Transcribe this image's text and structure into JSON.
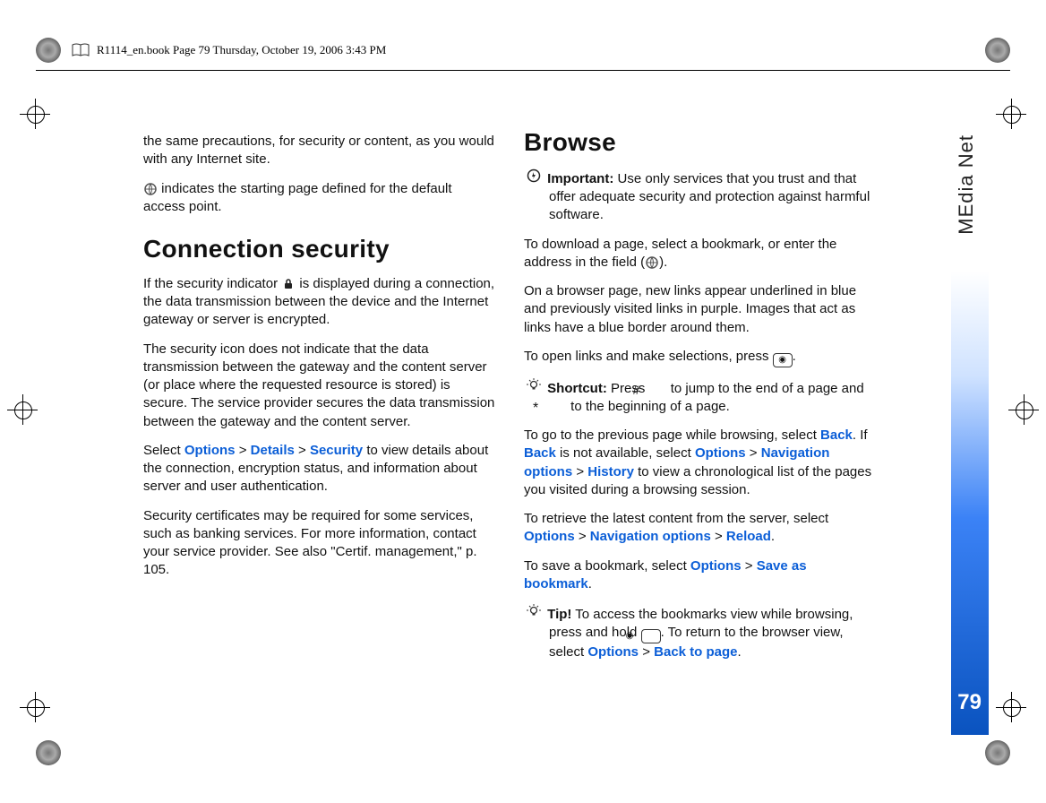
{
  "header": {
    "file_info": "R1114_en.book  Page 79  Thursday, October 19, 2006  3:43 PM"
  },
  "side": {
    "label": "MEdia Net",
    "page_number": "79"
  },
  "left": {
    "intro": "the same precautions, for security or content, as you would with any Internet site.",
    "start_page": " indicates the starting page defined for the default access point.",
    "h_conn": "Connection security",
    "conn_p1a": "If the security indicator ",
    "conn_p1b": " is displayed during a connection, the data transmission between the device and the Internet gateway or server is encrypted.",
    "conn_p2": "The security icon does not indicate that the data transmission between the gateway and the content server (or place where the requested resource is stored) is secure. The service provider secures the data transmission between the gateway and the content server.",
    "conn_p3_pre": "Select ",
    "options": "Options",
    "details": "Details",
    "security": "Security",
    "conn_p3_post": " to view details about the connection, encryption status, and information about server and user authentication.",
    "conn_p4": "Security certificates may be required for some services, such as banking services. For more information, contact your service provider. See also \"Certif. management,\" p. 105."
  },
  "right": {
    "h_browse": "Browse",
    "important_label": "Important:",
    "important_body": " Use only services that you trust and that offer adequate security and protection against harmful software.",
    "download_p_a": "To download a page, select a bookmark, or enter the address in the field (",
    "download_p_b": ").",
    "links_p": "On a browser page, new links appear underlined in blue and previously visited links in purple. Images that act as links have a blue border around them.",
    "open_p_a": "To open links and make selections, press ",
    "open_p_b": ".",
    "shortcut_label": "Shortcut:",
    "shortcut_body_a": " Press ",
    "shortcut_body_b": " to jump to the end of a page and ",
    "shortcut_body_c": " to the beginning of a page.",
    "prev_a": "To go to the previous page while browsing, select ",
    "back": "Back",
    "prev_b": ". If ",
    "prev_c": " is not available, select ",
    "nav_options": "Navigation options",
    "history": "History",
    "prev_d": " to view a chronological list of the pages you visited during a browsing session.",
    "reload_a": "To retrieve the latest content from the server, select ",
    "reload": "Reload",
    "reload_b": ".",
    "save_a": "To save a bookmark, select ",
    "save_bm": "Save as bookmark",
    "save_b": ".",
    "tip_label": "Tip!",
    "tip_body_a": " To access the bookmarks view while browsing, press and hold ",
    "tip_body_b": ". To return to the browser view, select ",
    "back_to_page": "Back to page",
    "tip_body_c": ".",
    "options": "Options"
  }
}
